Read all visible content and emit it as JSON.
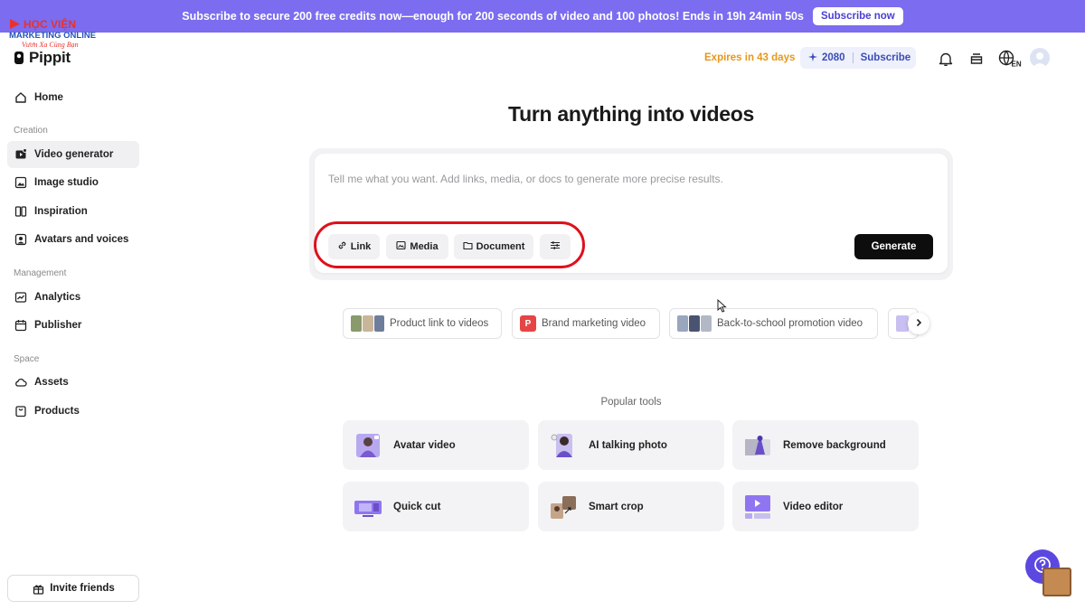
{
  "banner": {
    "text": "Subscribe to secure 200 free credits now—enough for 200 seconds of video and 100 photos! Ends in 19h 24min 50s",
    "button": "Subscribe now",
    "color": "#7b6cf0"
  },
  "watermark": {
    "line1": "HỌC VIỆN",
    "line2": "MARKETING ONLINE",
    "line3": "Vươn Xa Cùng Bạn"
  },
  "app": {
    "logo_text": "Pippit"
  },
  "sidebar": {
    "home": "Home",
    "sections": [
      "Creation",
      "Management",
      "Space"
    ],
    "creation_items": [
      {
        "label": "Video generator",
        "icon": "video-generator-icon",
        "active": true
      },
      {
        "label": "Image studio",
        "icon": "image-studio-icon"
      },
      {
        "label": "Inspiration",
        "icon": "inspiration-icon"
      },
      {
        "label": "Avatars and voices",
        "icon": "avatar-icon"
      }
    ],
    "management_items": [
      {
        "label": "Analytics",
        "icon": "analytics-icon"
      },
      {
        "label": "Publisher",
        "icon": "calendar-icon"
      }
    ],
    "space_items": [
      {
        "label": "Assets",
        "icon": "cloud-icon"
      },
      {
        "label": "Products",
        "icon": "bag-icon"
      }
    ],
    "invite": "Invite friends"
  },
  "header": {
    "expires": "Expires in 43 days",
    "credits": "2080",
    "subscribe": "Subscribe",
    "language": "EN"
  },
  "main": {
    "headline": "Turn anything into videos",
    "placeholder": "Tell me what you want. Add links, media, or docs to generate more precise results.",
    "chips": {
      "link": "Link",
      "media": "Media",
      "document": "Document"
    },
    "generate": "Generate",
    "suggestions": [
      "Product link to videos",
      "Brand marketing video",
      "Back-to-school promotion video"
    ],
    "popular_title": "Popular tools",
    "tools": [
      "Avatar video",
      "AI talking photo",
      "Remove background",
      "Quick cut",
      "Smart crop",
      "Video editor"
    ]
  },
  "colors": {
    "accent": "#5b48e0",
    "expires": "#e6971b",
    "highlight": "#e0101c"
  }
}
